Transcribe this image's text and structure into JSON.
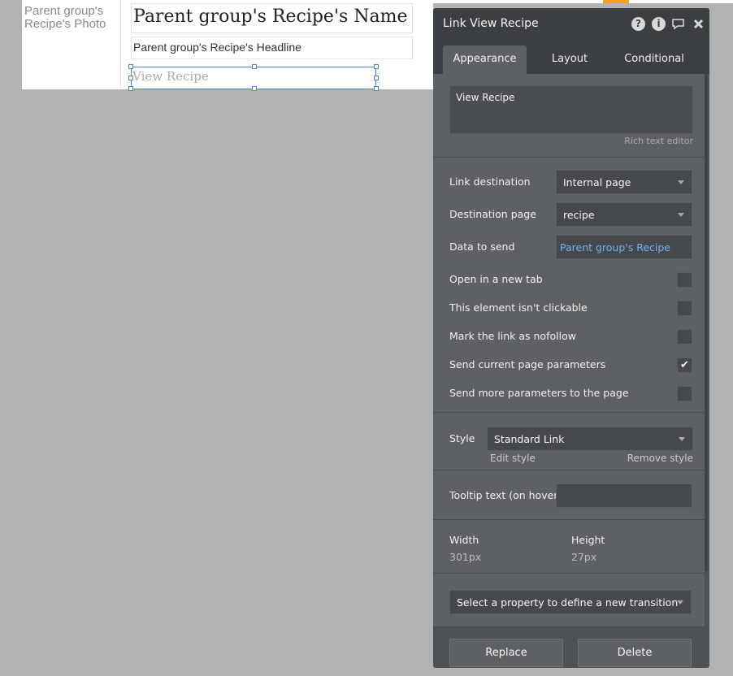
{
  "canvas": {
    "photo_label": "Parent group's Recipe's Photo",
    "recipe_name": "Parent group's Recipe's Name",
    "recipe_headline": "Parent group's Recipe's Headline",
    "link_text": "View Recipe"
  },
  "panel": {
    "title": "Link View Recipe",
    "icons": [
      "help-icon",
      "info-icon",
      "comment-icon",
      "close-icon"
    ],
    "tabs": [
      {
        "label": "Appearance",
        "active": true
      },
      {
        "label": "Layout",
        "active": false
      },
      {
        "label": "Conditional",
        "active": false
      }
    ],
    "text_value": "View Recipe",
    "rich_text_editor_label": "Rich text editor",
    "link_destination": {
      "label": "Link destination",
      "value": "Internal page"
    },
    "destination_page": {
      "label": "Destination page",
      "value": "recipe"
    },
    "data_to_send": {
      "label": "Data to send",
      "value": "Parent group's Recipe"
    },
    "checkboxes": [
      {
        "label": "Open in a new tab",
        "checked": false
      },
      {
        "label": "This element isn't clickable",
        "checked": false
      },
      {
        "label": "Mark the link as nofollow",
        "checked": false
      },
      {
        "label": "Send current page parameters",
        "checked": true
      },
      {
        "label": "Send more parameters to the page",
        "checked": false
      }
    ],
    "style": {
      "label": "Style",
      "value": "Standard Link",
      "edit_label": "Edit style",
      "remove_label": "Remove style"
    },
    "tooltip": {
      "label": "Tooltip text (on hover)",
      "value": ""
    },
    "width": {
      "label": "Width",
      "value": "301px"
    },
    "height": {
      "label": "Height",
      "value": "27px"
    },
    "transition_placeholder": "Select a property to define a new transition",
    "replace_label": "Replace",
    "delete_label": "Delete"
  },
  "colors": {
    "canvas_bg": "#b2b2b2",
    "panel_bg": "#4f5254",
    "panel_header": "#3c3f41",
    "link_blue": "#6fb0ff",
    "selection_blue": "#4d84c7",
    "accent_orange": "#f0a21d"
  }
}
